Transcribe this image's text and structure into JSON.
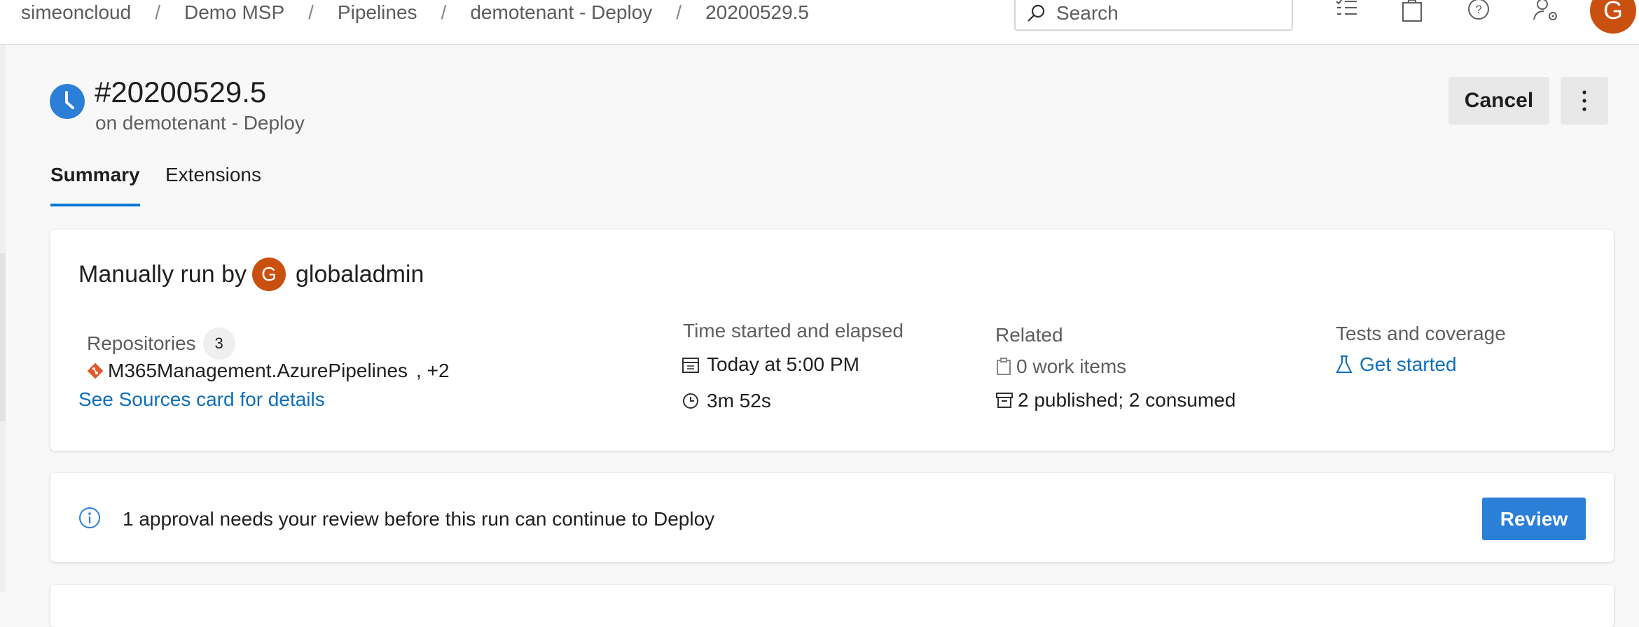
{
  "breadcrumb": {
    "items": [
      "simeoncloud",
      "Demo MSP",
      "Pipelines",
      "demotenant - Deploy",
      "20200529.5"
    ],
    "separator": "/"
  },
  "search": {
    "placeholder": "Search"
  },
  "user": {
    "initial": "G",
    "avatar_color": "#ca5010"
  },
  "run": {
    "title": "#20200529.5",
    "subtitle": "on demotenant - Deploy",
    "status_icon": "clock-icon",
    "status_color": "#2b7fd6"
  },
  "actions": {
    "cancel_label": "Cancel",
    "more_icon": "more-vertical-icon"
  },
  "tabs": [
    {
      "label": "Summary",
      "active": true
    },
    {
      "label": "Extensions",
      "active": false
    }
  ],
  "summary": {
    "manual_prefix": "Manually run by",
    "user_initial": "G",
    "user_name": "globaladmin",
    "repositories": {
      "label": "Repositories",
      "count": "3",
      "repo_name": "M365Management.AzurePipelines",
      "extra": ", +2",
      "link": "See Sources card for details"
    },
    "time": {
      "label": "Time started and elapsed",
      "started": "Today at 5:00 PM",
      "elapsed": "3m 52s"
    },
    "related": {
      "label": "Related",
      "work_items": "0 work items",
      "artifacts": "2 published; 2 consumed"
    },
    "tests": {
      "label": "Tests and coverage",
      "link": "Get started"
    }
  },
  "approval": {
    "message": "1 approval needs your review before this run can continue to Deploy",
    "review_label": "Review"
  },
  "colors": {
    "accent": "#0078d4",
    "link": "#106ebe",
    "primary_button": "#2b7fd6"
  }
}
